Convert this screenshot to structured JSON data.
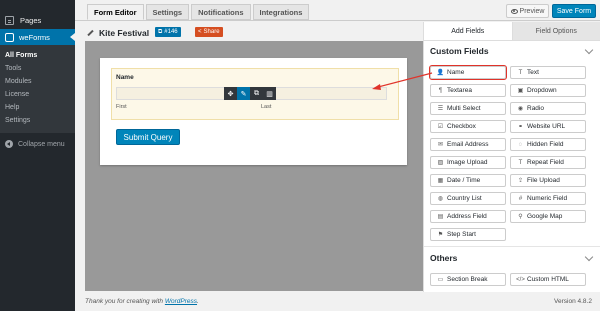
{
  "sidebar": {
    "pages_label": "Pages",
    "plugin_label": "weForms",
    "sub_items": [
      "All Forms",
      "Tools",
      "Modules",
      "License",
      "Help",
      "Settings"
    ],
    "collapse_label": "Collapse menu"
  },
  "tabs": [
    "Form Editor",
    "Settings",
    "Notifications",
    "Integrations"
  ],
  "header_actions": {
    "preview_label": "Preview",
    "save_label": "Save Form"
  },
  "form": {
    "title": "Kite Festival",
    "id_badge": "#146",
    "share_label": "Share",
    "field_label": "Name",
    "first_sub": "First",
    "last_sub": "Last",
    "submit_label": "Submit Query"
  },
  "panel": {
    "tabs": [
      "Add Fields",
      "Field Options"
    ],
    "custom_title": "Custom Fields",
    "custom_fields": [
      {
        "label": "Name",
        "icon": "user-icon",
        "glyph": "👤"
      },
      {
        "label": "Text",
        "icon": "text-icon",
        "glyph": "T"
      },
      {
        "label": "Textarea",
        "icon": "paragraph-icon",
        "glyph": "¶"
      },
      {
        "label": "Dropdown",
        "icon": "dropdown-icon",
        "glyph": "▣"
      },
      {
        "label": "Multi Select",
        "icon": "list-icon",
        "glyph": "☰"
      },
      {
        "label": "Radio",
        "icon": "radio-icon",
        "glyph": "◉"
      },
      {
        "label": "Checkbox",
        "icon": "checkbox-icon",
        "glyph": "☑"
      },
      {
        "label": "Website URL",
        "icon": "link-icon",
        "glyph": "⚭"
      },
      {
        "label": "Email Address",
        "icon": "envelope-icon",
        "glyph": "✉"
      },
      {
        "label": "Hidden Field",
        "icon": "eye-slash-icon",
        "glyph": "◌"
      },
      {
        "label": "Image Upload",
        "icon": "image-icon",
        "glyph": "▨"
      },
      {
        "label": "Repeat Field",
        "icon": "repeat-icon",
        "glyph": "T"
      },
      {
        "label": "Date / Time",
        "icon": "calendar-icon",
        "glyph": "▦"
      },
      {
        "label": "File Upload",
        "icon": "upload-icon",
        "glyph": "⇪"
      },
      {
        "label": "Country List",
        "icon": "globe-icon",
        "glyph": "◍"
      },
      {
        "label": "Numeric Field",
        "icon": "hash-icon",
        "glyph": "#"
      },
      {
        "label": "Address Field",
        "icon": "address-icon",
        "glyph": "▤"
      },
      {
        "label": "Google Map",
        "icon": "map-marker-icon",
        "glyph": "⚲"
      },
      {
        "label": "Step Start",
        "icon": "step-icon",
        "glyph": "⚑"
      }
    ],
    "others_title": "Others",
    "other_fields": [
      {
        "label": "Section Break",
        "icon": "section-break-icon",
        "glyph": "▭"
      },
      {
        "label": "Custom HTML",
        "icon": "code-icon",
        "glyph": "</>"
      }
    ]
  },
  "footer": {
    "thanks_prefix": "Thank you for creating with ",
    "thanks_link": "WordPress",
    "thanks_suffix": ".",
    "version": "Version 4.8.2"
  },
  "colors": {
    "wp_sidebar": "#23282d",
    "primary": "#0085ba",
    "share": "#d54e21",
    "highlight": "#e0332a"
  }
}
